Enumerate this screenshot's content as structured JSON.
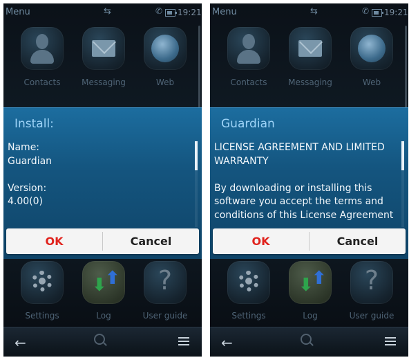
{
  "screens": [
    {
      "status": {
        "menu": "Menu",
        "time": "19:21"
      },
      "apps_row1": [
        {
          "label": "Contacts",
          "icon": "contacts-icon"
        },
        {
          "label": "Messaging",
          "icon": "messaging-icon"
        },
        {
          "label": "Web",
          "icon": "web-icon"
        }
      ],
      "dialog": {
        "title": "Install:",
        "paragraphs": [
          "Name:\nGuardian",
          "Version:\n4.00(0)"
        ]
      },
      "buttons": {
        "ok": "OK",
        "cancel": "Cancel"
      },
      "apps_row2": [
        {
          "label": "Settings",
          "icon": "settings-icon"
        },
        {
          "label": "Log",
          "icon": "log-icon"
        },
        {
          "label": "User guide",
          "icon": "user-guide-icon"
        }
      ]
    },
    {
      "status": {
        "menu": "Menu",
        "time": "19:21"
      },
      "apps_row1": [
        {
          "label": "Contacts",
          "icon": "contacts-icon"
        },
        {
          "label": "Messaging",
          "icon": "messaging-icon"
        },
        {
          "label": "Web",
          "icon": "web-icon"
        }
      ],
      "dialog": {
        "title": "Guardian",
        "paragraphs": [
          "LICENSE AGREEMENT AND LIMITED\nWARRANTY",
          "By downloading or installing this\nsoftware you accept the terms and\nconditions of this License Agreement"
        ]
      },
      "buttons": {
        "ok": "OK",
        "cancel": "Cancel"
      },
      "apps_row2": [
        {
          "label": "Settings",
          "icon": "settings-icon"
        },
        {
          "label": "Log",
          "icon": "log-icon"
        },
        {
          "label": "User guide",
          "icon": "user-guide-icon"
        }
      ]
    }
  ]
}
